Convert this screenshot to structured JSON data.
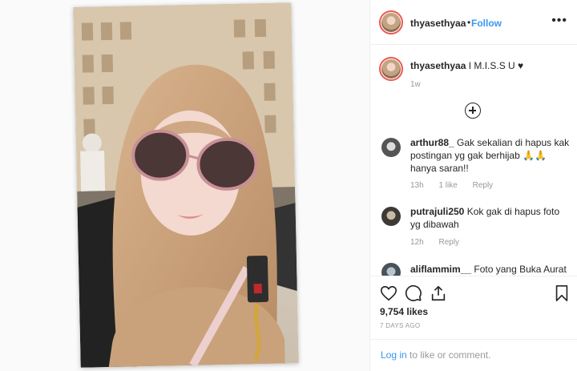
{
  "header": {
    "username": "thyasethyaa",
    "separator": "•",
    "follow_label": "Follow",
    "more_label": "•••"
  },
  "caption": {
    "username": "thyasethyaa",
    "text": "I M.I.S.S U ♥",
    "time": "1w"
  },
  "comments": [
    {
      "username": "arthur88_",
      "text": "Gak sekalian di hapus kak postingan yg gak berhijab 🙏🙏 hanya saran!!",
      "time": "13h",
      "likes": "1 like",
      "reply": "Reply"
    },
    {
      "username": "putrajuli250",
      "text": "Kok gak di hapus foto yg dibawah",
      "time": "12h",
      "reply": "Reply"
    },
    {
      "username": "aliflammim__",
      "text": "Foto yang Buka Aurat"
    }
  ],
  "likes_text": "9,754 likes",
  "posted_text": "7 DAYS AGO",
  "login": {
    "link_label": "Log in",
    "suffix": " to like or comment."
  },
  "icons": [
    "heart-icon",
    "comment-icon",
    "share-icon",
    "bookmark-icon",
    "plus-circle-icon"
  ],
  "colors": {
    "link": "#3897f0",
    "muted": "#999999",
    "ring": "#e95950"
  }
}
